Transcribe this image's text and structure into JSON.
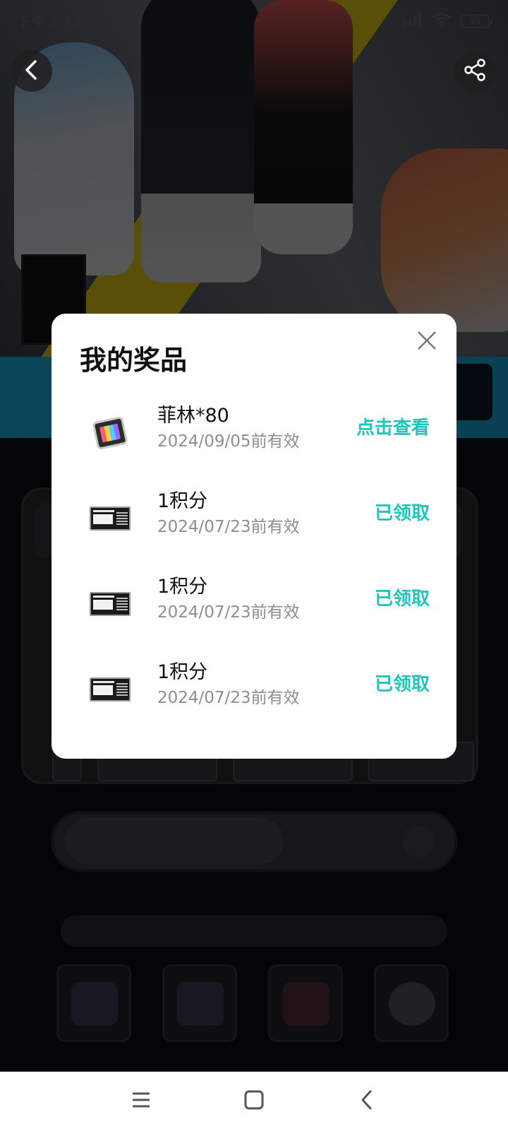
{
  "status_bar": {
    "time": "下午3:22",
    "battery": "95"
  },
  "modal": {
    "title": "我的奖品",
    "items": [
      {
        "name": "菲林*80",
        "expiry": "2024/09/05前有效",
        "action": "点击查看",
        "icon": "film-ticket-icon"
      },
      {
        "name": "1积分",
        "expiry": "2024/07/23前有效",
        "action": "已领取",
        "icon": "integral-card-icon"
      },
      {
        "name": "1积分",
        "expiry": "2024/07/23前有效",
        "action": "已领取",
        "icon": "integral-card-icon"
      },
      {
        "name": "1积分",
        "expiry": "2024/07/23前有效",
        "action": "已领取",
        "icon": "integral-card-icon"
      }
    ]
  },
  "colors": {
    "accent": "#22c4b9",
    "modal_bg": "#ffffff",
    "overlay": "rgba(0,0,0,0.62)"
  }
}
